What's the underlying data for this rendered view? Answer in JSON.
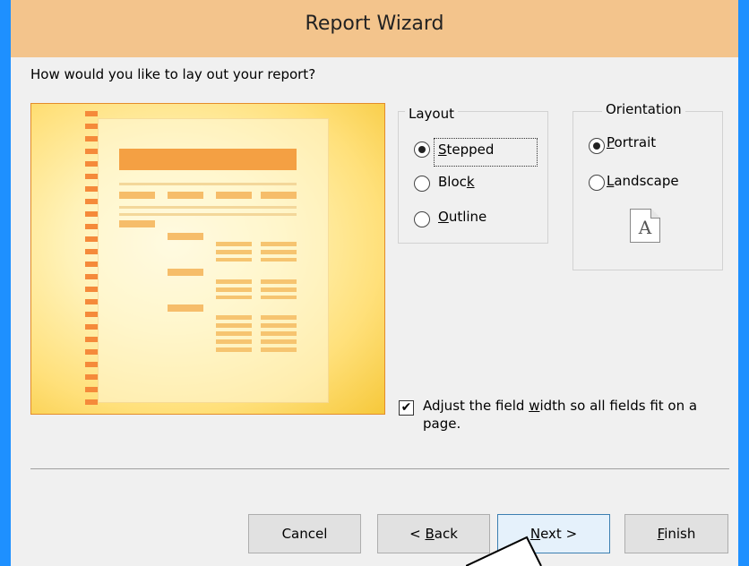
{
  "window": {
    "title": "Report Wizard"
  },
  "question": "How would you like to lay out your report?",
  "layout": {
    "label": "Layout",
    "options": [
      {
        "label": "Stepped",
        "accel": "S",
        "rest": "tepped",
        "checked": true
      },
      {
        "label": "Block",
        "pre": "Bloc",
        "accel": "k",
        "checked": false
      },
      {
        "label": "Outline",
        "accel": "O",
        "rest": "utline",
        "checked": false
      }
    ]
  },
  "orientation": {
    "label": "Orientation",
    "options": [
      {
        "label": "Portrait",
        "accel": "P",
        "rest": "ortrait",
        "checked": true
      },
      {
        "label": "Landscape",
        "accel": "L",
        "rest": "andscape",
        "checked": false
      }
    ],
    "icon_letter": "A"
  },
  "adjust_checkbox": {
    "checked": true,
    "text_pre": "Adjust the field ",
    "accel": "w",
    "text_post": "idth so all fields fit on a page."
  },
  "buttons": {
    "cancel": "Cancel",
    "back_pre": "< ",
    "back_accel": "B",
    "back_rest": "ack",
    "next_accel": "N",
    "next_rest": "ext >",
    "finish_accel": "F",
    "finish_rest": "inish"
  },
  "colors": {
    "frame": "#1e90ff",
    "titlebar": "#f3c48c",
    "dialog_bg": "#f0f0f0",
    "preview_border": "#e48c2a"
  }
}
